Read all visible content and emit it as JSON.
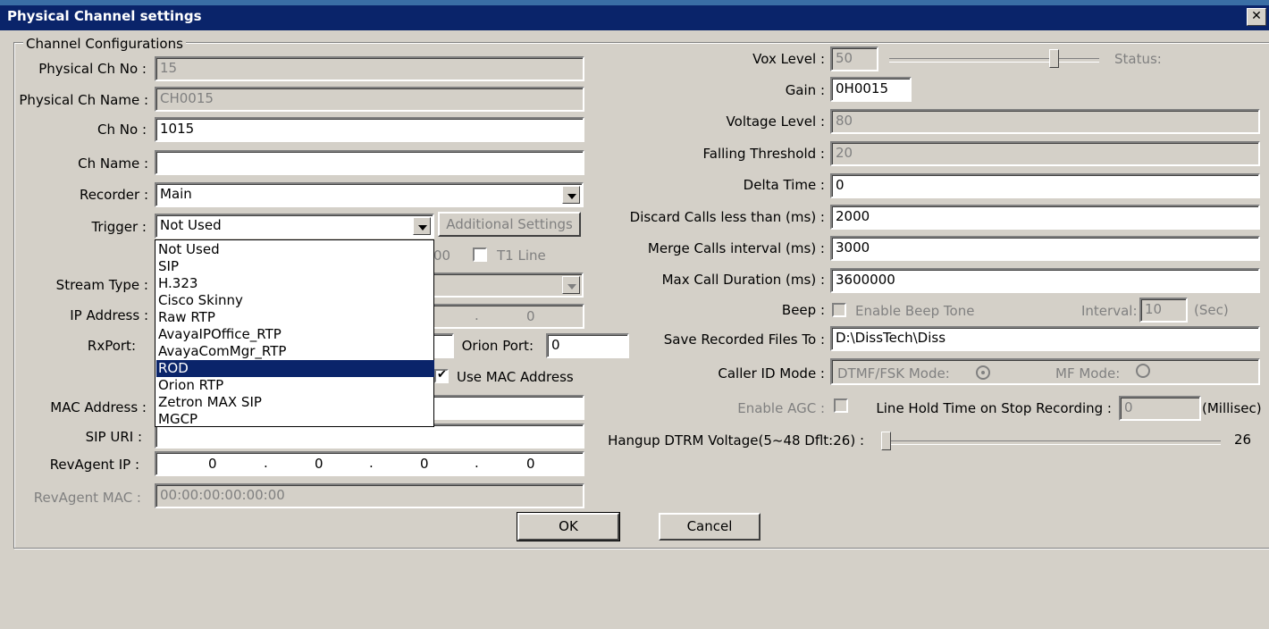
{
  "window": {
    "title": "Physical Channel settings",
    "close_glyph": "✕"
  },
  "group": {
    "legend": "Channel Configurations"
  },
  "left": {
    "physical_ch_no": {
      "label": "Physical Ch No :",
      "value": "15"
    },
    "physical_ch_name": {
      "label": "Physical Ch Name :",
      "value": "CH0015"
    },
    "ch_no": {
      "label": "Ch No :",
      "value": "1015"
    },
    "ch_name": {
      "label": "Ch Name :",
      "value": ""
    },
    "recorder": {
      "label": "Recorder :",
      "value": "Main"
    },
    "trigger": {
      "label": "Trigger :",
      "value": "Not Used",
      "options": [
        "Not Used",
        "SIP",
        "H.323",
        "Cisco Skinny",
        "Raw RTP",
        "AvayaIPOffice_RTP",
        "AvayaComMgr_RTP",
        "ROD",
        "Orion RTP",
        "Zetron MAX SIP",
        "MGCP"
      ],
      "selected_index": 7
    },
    "additional_settings": "Additional Settings",
    "partial_hidden_text": "00",
    "t1_line": "T1 Line",
    "stream_type": {
      "label": "Stream Type :",
      "value": ""
    },
    "ip_address": {
      "label": "IP Address :",
      "last_octet": "0",
      "dot": "."
    },
    "rxport": {
      "label": "RxPort:",
      "value": ""
    },
    "orion_port": {
      "label": "Orion Port:",
      "value": "0"
    },
    "use_mac": {
      "label": "Use MAC Address",
      "checked": true
    },
    "mac_address": {
      "label": "MAC Address :",
      "value": ""
    },
    "sip_uri": {
      "label": "SIP URI :",
      "value": ""
    },
    "revagent_ip": {
      "label": "RevAgent IP :",
      "octets": [
        "0",
        "0",
        "0",
        "0"
      ],
      "dot": "."
    },
    "revagent_mac": {
      "label": "RevAgent MAC :",
      "value": "00:00:00:00:00:00"
    }
  },
  "right": {
    "vox_level": {
      "label": "Vox Level :",
      "value": "50",
      "slider_level": 0.8
    },
    "status": "Status:",
    "gain": {
      "label": "Gain :",
      "value": "0H0015"
    },
    "voltage_level": {
      "label": "Voltage Level :",
      "value": "80"
    },
    "falling_threshold": {
      "label": "Falling Threshold :",
      "value": "20"
    },
    "delta_time": {
      "label": "Delta Time :",
      "value": "0"
    },
    "discard_calls": {
      "label": "Discard Calls less than (ms) :",
      "value": "2000"
    },
    "merge_calls": {
      "label": "Merge Calls interval (ms) :",
      "value": "3000"
    },
    "max_call_duration": {
      "label": "Max Call Duration (ms) :",
      "value": "3600000"
    },
    "beep": {
      "label": "Beep :",
      "checkbox_label": "Enable Beep Tone",
      "interval_label": "Interval:",
      "interval_value": "10",
      "unit": "(Sec)"
    },
    "save_files": {
      "label": "Save Recorded Files To :",
      "value": "D:\\DissTech\\Diss"
    },
    "caller_id": {
      "label": "Caller ID Mode :",
      "dtmf_label": "DTMF/FSK Mode:",
      "mf_label": "MF Mode:",
      "selected": "DTMF/FSK"
    },
    "enable_agc": {
      "label": "Enable AGC :"
    },
    "line_hold": {
      "label": "Line Hold Time on Stop Recording :",
      "value": "0",
      "unit": "(Millisec)"
    },
    "hangup": {
      "label": "Hangup DTRM Voltage(5~48 Dflt:26) :",
      "value": "26",
      "slider_level": 0
    }
  },
  "buttons": {
    "ok": "OK",
    "cancel": "Cancel"
  }
}
